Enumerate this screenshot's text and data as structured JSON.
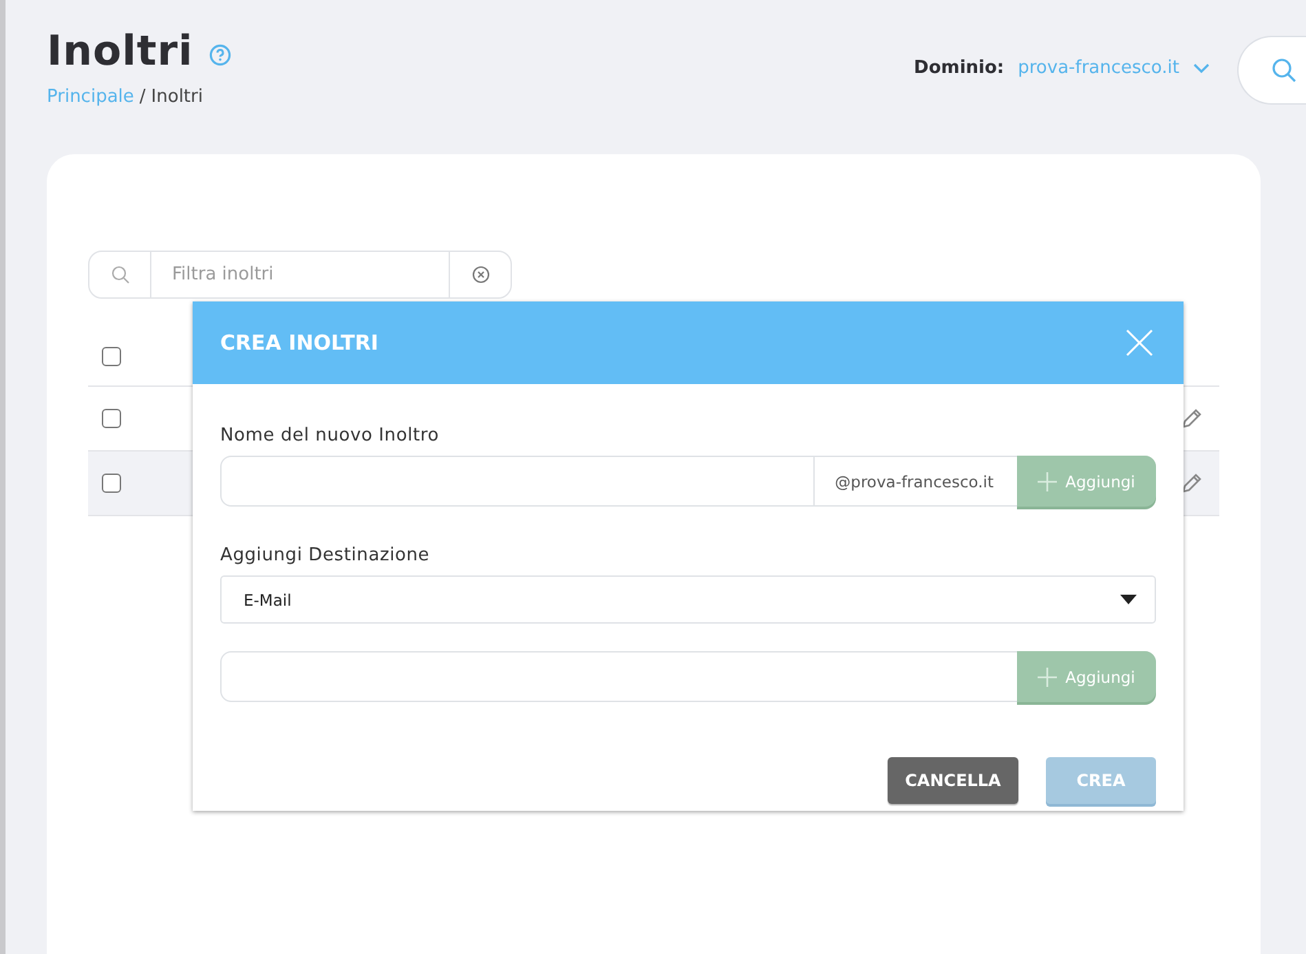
{
  "header": {
    "title": "Inoltri",
    "breadcrumb": [
      {
        "kind": "link",
        "label": "Principale"
      },
      {
        "kind": "separator",
        "label": "/"
      },
      {
        "kind": "current",
        "label": "Inoltri"
      }
    ],
    "domain_label": "Dominio:",
    "domain": "prova-francesco.it"
  },
  "filter": {
    "placeholder": "Filtra inoltri"
  },
  "table": {
    "header_checked": false,
    "rows": [
      {
        "checked": false,
        "selected": false
      },
      {
        "checked": false,
        "selected": true
      }
    ]
  },
  "modal": {
    "title": "CREA INOLTRI",
    "name_label": "Nome del nuovo Inoltro",
    "domain_suffix": "@prova-francesco.it",
    "add_button": "Aggiungi",
    "destination_label": "Aggiungi Destinazione",
    "destination_type": "E-Mail",
    "destination_add_button": "Aggiungi",
    "cancel_button": "CANCELLA",
    "create_button": "CREA",
    "create_disabled": true
  }
}
